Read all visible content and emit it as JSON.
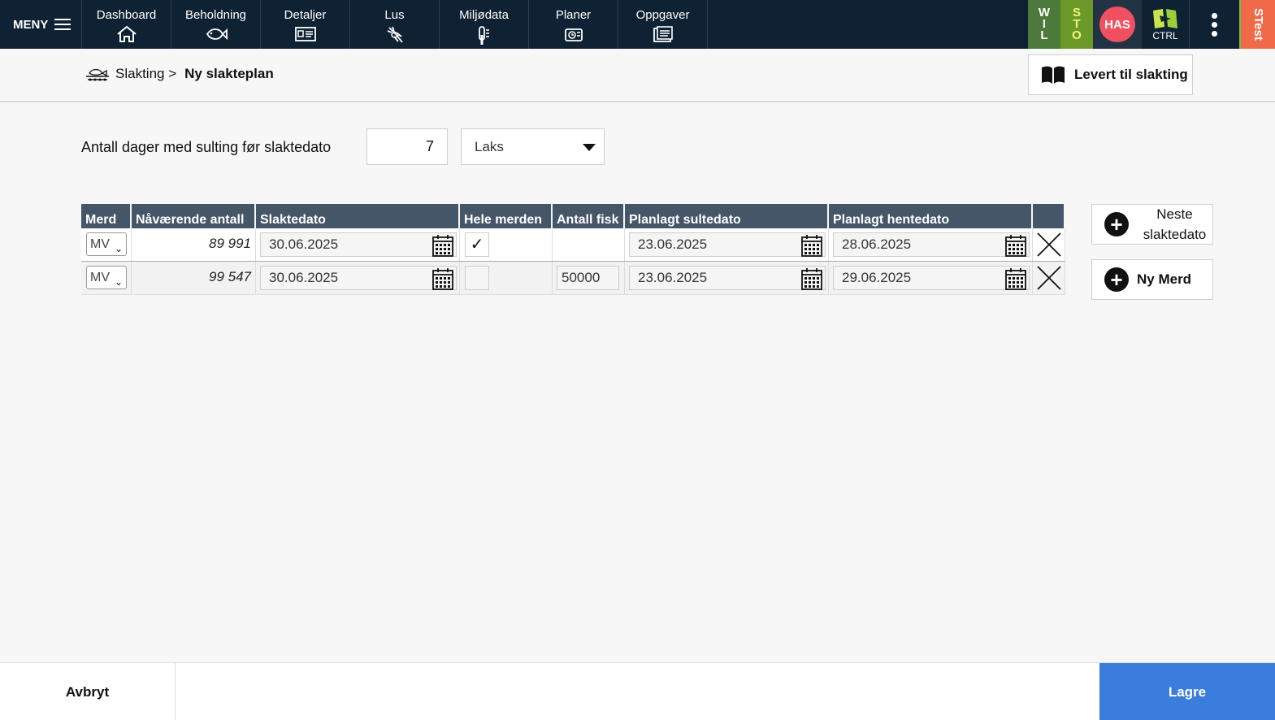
{
  "nav": {
    "menu_label": "MENY",
    "items": [
      {
        "label": "Dashboard",
        "icon": "home-icon"
      },
      {
        "label": "Beholdning",
        "icon": "fish-icon"
      },
      {
        "label": "Detaljer",
        "icon": "id-card-icon"
      },
      {
        "label": "Lus",
        "icon": "louse-icon"
      },
      {
        "label": "Miljødata",
        "icon": "thermometer-icon"
      },
      {
        "label": "Planer",
        "icon": "plans-icon"
      },
      {
        "label": "Oppgaver",
        "icon": "tasks-icon"
      }
    ],
    "tiles": {
      "wil": [
        "W",
        "I",
        "L"
      ],
      "sto": [
        "S",
        "T",
        "O"
      ],
      "has": "HAS",
      "ctrl": "CTRL",
      "stest": "STest"
    }
  },
  "breadcrumb": {
    "parent": "Slakting >",
    "current": "Ny slakteplan"
  },
  "levert_button": "Levert til slakting",
  "form": {
    "sult_label": "Antall dager med sulting før slaktedato",
    "sult_days": "7",
    "species": "Laks"
  },
  "table": {
    "headers": [
      "Merd",
      "Nåværende antall",
      "Slaktedato",
      "Hele merden",
      "Antall fisk",
      "Planlagt sultedato",
      "Planlagt hentedato",
      ""
    ],
    "rows": [
      {
        "merd": "MV",
        "current_count": "89 991",
        "slaktedato": "30.06.2025",
        "hele_merden": "✓",
        "antall_fisk": "",
        "sultedato": "23.06.2025",
        "hentedato": "28.06.2025"
      },
      {
        "merd": "MV",
        "current_count": "99 547",
        "slaktedato": "30.06.2025",
        "hele_merden": "",
        "antall_fisk": "50000",
        "sultedato": "23.06.2025",
        "hentedato": "29.06.2025"
      }
    ]
  },
  "side_buttons": {
    "neste_line1": "Neste",
    "neste_line2": "slaktedato",
    "ny_merd": "Ny Merd"
  },
  "footer": {
    "cancel": "Avbryt",
    "save": "Lagre"
  },
  "colors": {
    "nav_bg": "#0f2233",
    "header_bg": "#465669",
    "save_bg": "#3b7ddd",
    "has_badge": "#f05060",
    "stest_tile": "#f06a4a"
  }
}
